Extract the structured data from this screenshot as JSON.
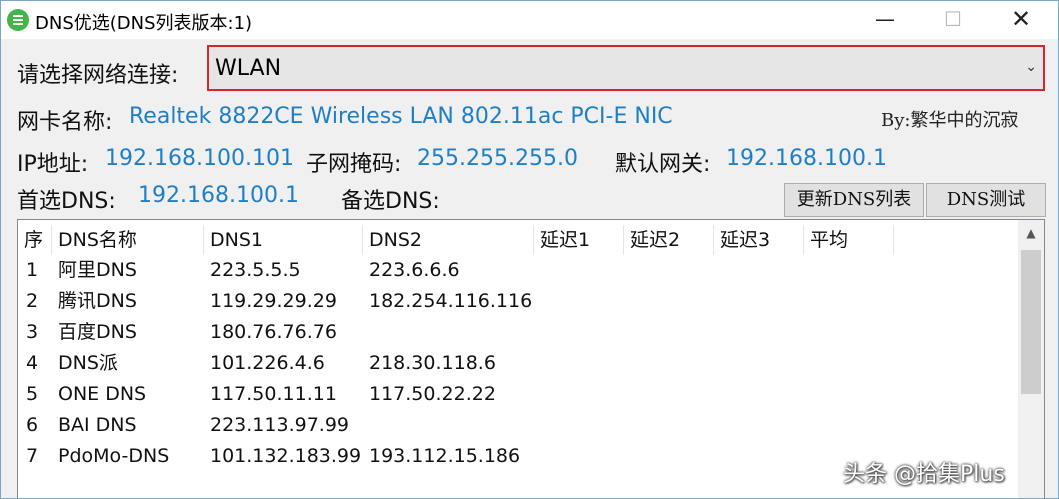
{
  "window": {
    "title": "DNS优选(DNS列表版本:1)",
    "controls": {
      "minimize": "—",
      "maximize": "☐",
      "close": "✕"
    }
  },
  "network": {
    "label": "请选择网络连接:",
    "selected": "WLAN"
  },
  "adapter": {
    "label": "网卡名称:",
    "value": "Realtek 8822CE Wireless LAN 802.11ac PCI-E NIC"
  },
  "author": "By:繁华中的沉寂",
  "ip": {
    "ip_label": "IP地址:",
    "ip_value": "192.168.100.101",
    "mask_label": "子网掩码:",
    "mask_value": "255.255.255.0",
    "gateway_label": "默认网关:",
    "gateway_value": "192.168.100.1"
  },
  "dns": {
    "preferred_label": "首选DNS:",
    "preferred_value": "192.168.100.1",
    "alternate_label": "备选DNS:",
    "alternate_value": ""
  },
  "buttons": {
    "update_list": "更新DNS列表",
    "dns_test": "DNS测试"
  },
  "table": {
    "columns": [
      "序",
      "DNS名称",
      "DNS1",
      "DNS2",
      "延迟1",
      "延迟2",
      "延迟3",
      "平均"
    ],
    "rows": [
      [
        "1",
        "阿里DNS",
        "223.5.5.5",
        "223.6.6.6"
      ],
      [
        "2",
        "腾讯DNS",
        "119.29.29.29",
        "182.254.116.116"
      ],
      [
        "3",
        "百度DNS",
        "180.76.76.76",
        ""
      ],
      [
        "4",
        "DNS派",
        "101.226.4.6",
        "218.30.118.6"
      ],
      [
        "5",
        "ONE DNS",
        "117.50.11.11",
        "117.50.22.22"
      ],
      [
        "6",
        "BAI DNS",
        "223.113.97.99",
        ""
      ],
      [
        "7",
        "PdoMo-DNS",
        "101.132.183.99",
        "193.112.15.186"
      ]
    ]
  },
  "icons": {
    "app": "app-logo-icon",
    "dropdown": "chevron-down-icon",
    "scroll_up": "scroll-up-arrow-icon"
  },
  "watermark": "头条 @拾集Plus"
}
